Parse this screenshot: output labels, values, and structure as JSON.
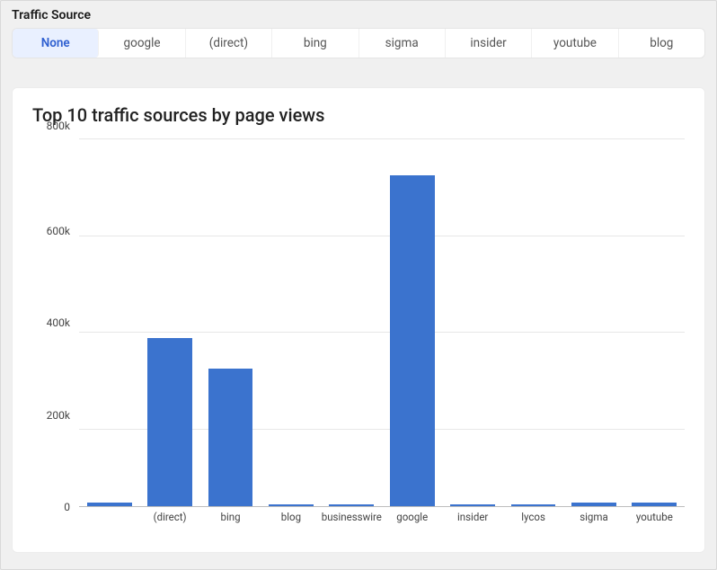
{
  "header": {
    "title": "Traffic Source"
  },
  "tabs": {
    "items": [
      "None",
      "google",
      "(direct)",
      "bing",
      "sigma",
      "insider",
      "youtube",
      "blog"
    ],
    "active_index": 0
  },
  "card": {
    "title": "Top 10 traffic sources by page views"
  },
  "chart_data": {
    "type": "bar",
    "title": "Top 10 traffic sources by page views",
    "xlabel": "",
    "ylabel": "",
    "ylim": [
      0,
      800000
    ],
    "y_ticks": [
      0,
      200000,
      400000,
      600000,
      800000
    ],
    "y_tick_labels": [
      "0",
      "200k",
      "400k",
      "600k",
      "800k"
    ],
    "categories": [
      "",
      "(direct)",
      "bing",
      "blog",
      "businesswire",
      "google",
      "insider",
      "lycos",
      "sigma",
      "youtube"
    ],
    "values": [
      8000,
      365000,
      300000,
      3000,
      3000,
      720000,
      3000,
      3000,
      7000,
      7000
    ],
    "bar_color": "#3b73ce"
  }
}
